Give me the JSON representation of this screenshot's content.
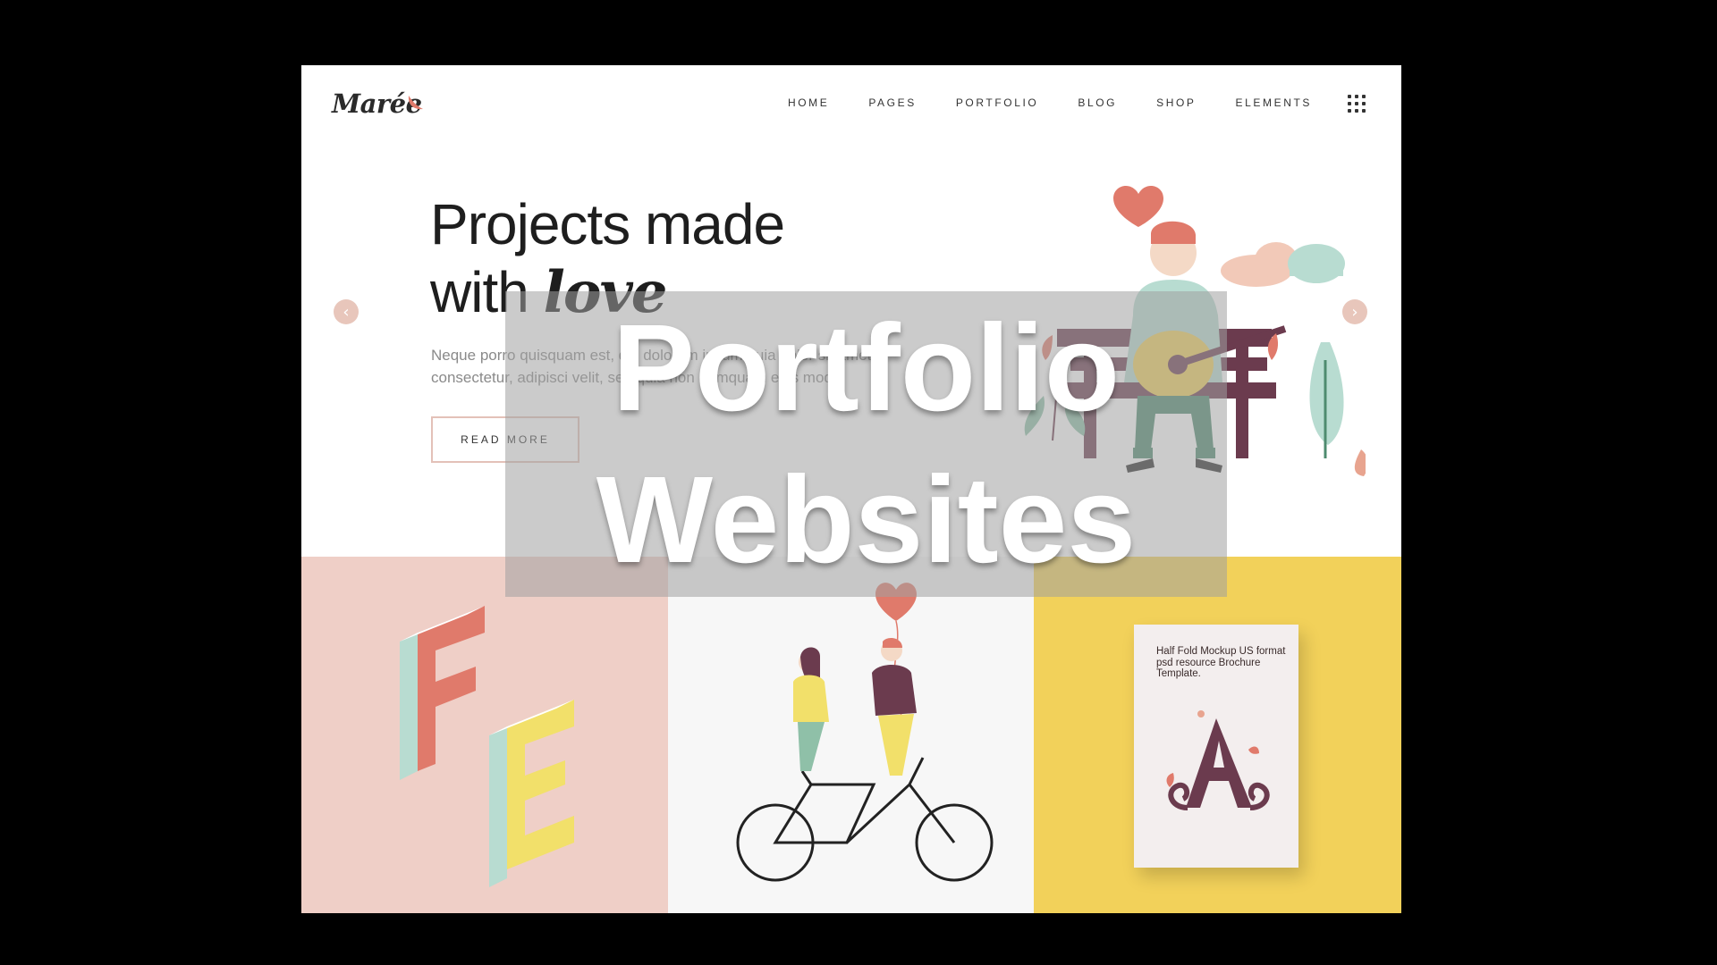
{
  "brand": {
    "logo": "Marée"
  },
  "nav": {
    "items": [
      "HOME",
      "PAGES",
      "PORTFOLIO",
      "BLOG",
      "SHOP",
      "ELEMENTS"
    ],
    "active": "HOME"
  },
  "hero": {
    "title_line1": "Projects made",
    "title_line2_plain": "with ",
    "title_line2_em": "love",
    "text_line1": "Neque porro quisquam est, qui dolorem ipsum quia dolor sit amet,",
    "text_line2": "consectetur, adipisci velit, sed quia non numquam eius modi",
    "button": "READ MORE"
  },
  "arrows": {
    "prev": "‹",
    "next": "›"
  },
  "tiles": {
    "brochure_text": "Half Fold Mockup US format psd resource Brochure Template."
  },
  "overlay": {
    "line1": "Portfolio",
    "line2": "Websites"
  },
  "colors": {
    "accent": "#e07a6b",
    "pink_tile": "#efcfc7",
    "yellow_tile": "#f2d15a",
    "plum": "#6b3b4e"
  }
}
